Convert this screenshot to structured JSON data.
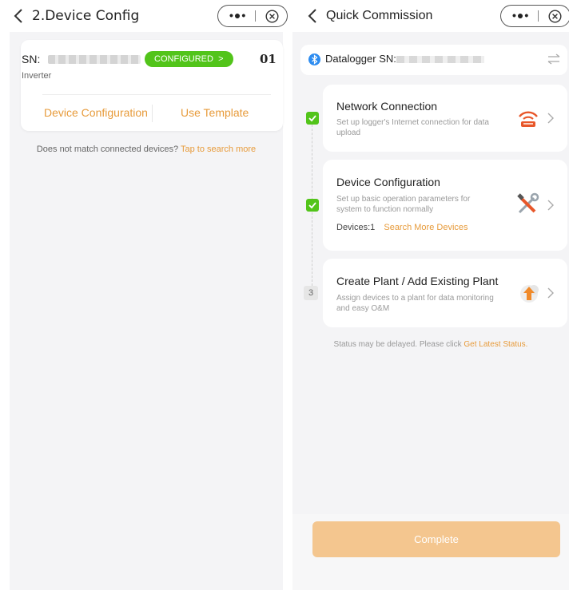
{
  "left": {
    "header": {
      "title": "2.Device Config"
    },
    "device": {
      "sn_label": "SN:",
      "status_badge": "CONFIGURED",
      "badge_arrow": ">",
      "index": "01",
      "type": "Inverter",
      "actions": [
        "Device Configuration",
        "Use Template"
      ]
    },
    "hint": {
      "text": "Does not match connected devices?",
      "link": "Tap to search more"
    }
  },
  "right": {
    "header": {
      "title": "Quick Commission"
    },
    "datalogger": {
      "label": "Datalogger SN:"
    },
    "steps": [
      {
        "title": "Network Connection",
        "desc": "Set up logger's Internet connection for data upload",
        "state": "done",
        "icon": "router-signal-icon"
      },
      {
        "title": "Device Configuration",
        "desc": "Set up basic operation parameters for system to function normally",
        "state": "done",
        "icon": "tools-icon",
        "devices": "Devices:1",
        "search_link": "Search More Devices"
      },
      {
        "title": "Create Plant / Add Existing Plant",
        "desc": "Assign devices to a plant for data monitoring and easy O&M",
        "state": "pending",
        "number": "3",
        "icon": "cloud-upload-icon"
      }
    ],
    "status": {
      "text": "Status may be delayed. Please click",
      "link": "Get Latest Status."
    },
    "complete_button": "Complete"
  },
  "capsule": {
    "more_glyph": "•●•",
    "close_icon": "close-circle-icon"
  },
  "colors": {
    "accent": "#e79b3b",
    "success": "#52c41a",
    "complete_bg": "#f4c68f",
    "bluetooth": "#2d8cf0"
  }
}
